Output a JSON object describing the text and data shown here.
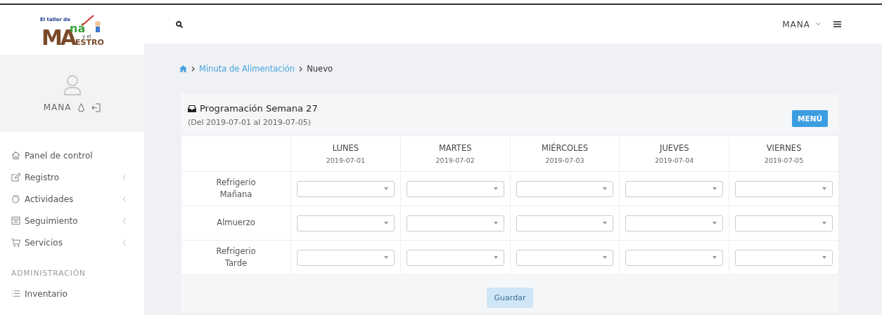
{
  "logo": {
    "texts": [
      "El taller de",
      "MA",
      "ná",
      "y el",
      "ESTRO"
    ]
  },
  "user": {
    "name": "MANA"
  },
  "sidebar": {
    "items": [
      {
        "label": "Panel de control",
        "expandable": false
      },
      {
        "label": "Registro",
        "expandable": true
      },
      {
        "label": "Actividades",
        "expandable": true
      },
      {
        "label": "Seguimiento",
        "expandable": true
      },
      {
        "label": "Servicios",
        "expandable": true
      }
    ],
    "section": "ADMINISTRACIÓN",
    "section_items": [
      {
        "label": "Inventario",
        "expandable": false
      }
    ]
  },
  "topbar": {
    "user": "MANA"
  },
  "breadcrumb": [
    "Minuta de Alimentación",
    "Nuevo"
  ],
  "card": {
    "title": "Programación Semana 27",
    "subtitle": "(Del 2019-07-01 al 2019-07-05)",
    "menu_button": "MENÚ",
    "table": {
      "columns": [
        {
          "day": "LUNES",
          "date": "2019-07-01"
        },
        {
          "day": "MARTES",
          "date": "2019-07-02"
        },
        {
          "day": "MIÉRCOLES",
          "date": "2019-07-03"
        },
        {
          "day": "JUEVES",
          "date": "2019-07-04"
        },
        {
          "day": "VIERNES",
          "date": "2019-07-05"
        }
      ],
      "rows": [
        {
          "label": "Refrigerio Mañana"
        },
        {
          "label": "Almuerzo"
        },
        {
          "label": "Refrigerio Tarde"
        }
      ]
    },
    "save_button": "Guardar"
  }
}
